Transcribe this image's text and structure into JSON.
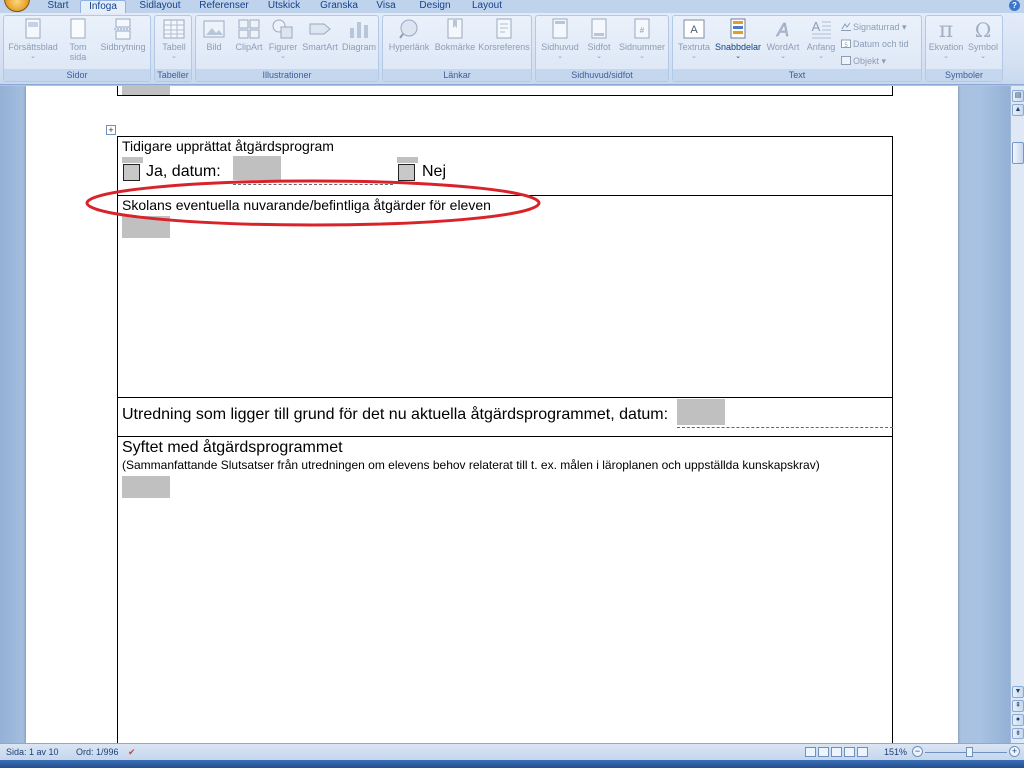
{
  "ribbon": {
    "tabs": [
      "Start",
      "Infoga",
      "Sidlayout",
      "Referenser",
      "Utskick",
      "Granska",
      "Visa",
      "Design",
      "Layout"
    ],
    "active_tab": "Infoga",
    "groups": {
      "sidor": {
        "label": "Sidor",
        "buttons": [
          "Försättsblad",
          "Tom sida",
          "Sidbrytning"
        ]
      },
      "tabeller": {
        "label": "Tabeller",
        "buttons": [
          "Tabell"
        ]
      },
      "illustrationer": {
        "label": "Illustrationer",
        "buttons": [
          "Bild",
          "ClipArt",
          "Figurer",
          "SmartArt",
          "Diagram"
        ]
      },
      "lankar": {
        "label": "Länkar",
        "buttons": [
          "Hyperlänk",
          "Bokmärke",
          "Korsreferens"
        ]
      },
      "sidhuvud": {
        "label": "Sidhuvud/sidfot",
        "buttons": [
          "Sidhuvud",
          "Sidfot",
          "Sidnummer"
        ]
      },
      "text": {
        "label": "Text",
        "buttons": [
          "Textruta",
          "Snabbdelar",
          "WordArt",
          "Anfang"
        ],
        "small": [
          "Signaturrad",
          "Datum och tid",
          "Objekt"
        ]
      },
      "symboler": {
        "label": "Symboler",
        "buttons": [
          "Ekvation",
          "Symbol"
        ]
      }
    }
  },
  "document": {
    "prev_heading": "Tidigare upprättat åtgärdsprogram",
    "yes_label": "Ja, datum:",
    "no_label": "Nej",
    "current_measures": "Skolans eventuella nuvarande/befintliga åtgärder för eleven",
    "investigation": "Utredning som ligger till grund för det nu aktuella åtgärdsprogrammet, datum:",
    "purpose_heading": "Syftet med åtgärdsprogrammet",
    "purpose_sub": "(Sammanfattande Slutsatser från utredningen om elevens behov relaterat till t. ex. målen i läroplanen och uppställda kunskapskrav)"
  },
  "status": {
    "page": "Sida: 1 av 10",
    "words": "Ord: 1/996",
    "zoom": "151%"
  },
  "colors": {
    "annotation": "#d9232b",
    "field_gray": "#c0c0c0",
    "ribbon_text": "#15428b"
  }
}
